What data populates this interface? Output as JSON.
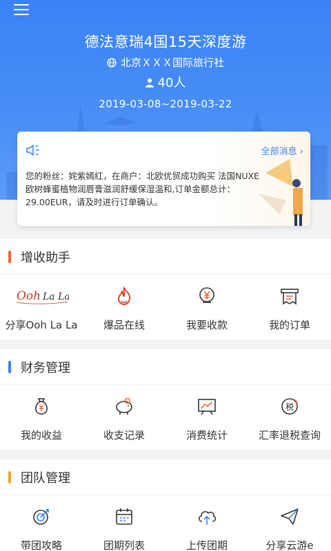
{
  "header": {
    "title": "德法意瑞4国15天深度游",
    "agency": "北京ＸＸＸ国际旅行社",
    "people": "40人",
    "dates": "2019-03-08~2019-03-22"
  },
  "messages": {
    "all_link": "全部消息",
    "text": "您的粉丝：姹紫嫣红，在商户：北欧优贸成功购买 法国NUXE欧树蜂蜜植物润唇膏滋润舒缓保湿温和,订单金额总计：29.00EUR，请及时进行订单确认。"
  },
  "sections": [
    {
      "title": "增收助手",
      "accent": "#f0672a",
      "items": [
        {
          "label": "分享Ooh La La",
          "icon": "ooh-la-la-logo"
        },
        {
          "label": "爆品在线",
          "icon": "flame-icon"
        },
        {
          "label": "我要收款",
          "icon": "yen-collect-icon"
        },
        {
          "label": "我的订单",
          "icon": "order-icon"
        }
      ]
    },
    {
      "title": "财务管理",
      "accent": "#3a82f5",
      "items": [
        {
          "label": "我的收益",
          "icon": "money-bag-icon"
        },
        {
          "label": "收支记录",
          "icon": "piggy-bank-icon"
        },
        {
          "label": "消费统计",
          "icon": "chart-board-icon"
        },
        {
          "label": "汇率退税查询",
          "icon": "tax-icon"
        }
      ]
    },
    {
      "title": "团队管理",
      "accent": "#f5a623",
      "items": [
        {
          "label": "带团攻略",
          "icon": "target-icon"
        },
        {
          "label": "团期列表",
          "icon": "calendar-icon"
        },
        {
          "label": "上传团期",
          "icon": "cloud-upload-icon"
        },
        {
          "label": "分享云游e",
          "icon": "paper-plane-icon"
        }
      ]
    }
  ],
  "logo_text": "Ooh La La",
  "colors": {
    "primary": "#3a82f5",
    "accent_orange": "#f0672a",
    "accent_gold": "#f5a623"
  }
}
